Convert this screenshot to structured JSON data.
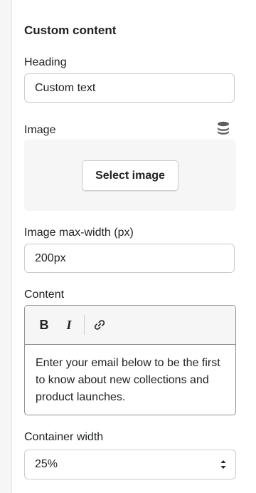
{
  "section": {
    "title": "Custom content"
  },
  "heading": {
    "label": "Heading",
    "value": "Custom text"
  },
  "image": {
    "label": "Image",
    "button_label": "Select image",
    "icon": "database-icon"
  },
  "image_max_width": {
    "label": "Image max-width (px)",
    "value": "200px"
  },
  "content": {
    "label": "Content",
    "toolbar": {
      "bold": "B",
      "italic": "I",
      "link_icon": "link-icon"
    },
    "text": "Enter your email below to be the first to know about new collections and product launches."
  },
  "container_width": {
    "label": "Container width",
    "value": "25%"
  },
  "colors": {
    "panel_bg": "#ffffff",
    "subdued_bg": "#f6f6f7",
    "border": "#c9cccf",
    "text": "#202223"
  }
}
